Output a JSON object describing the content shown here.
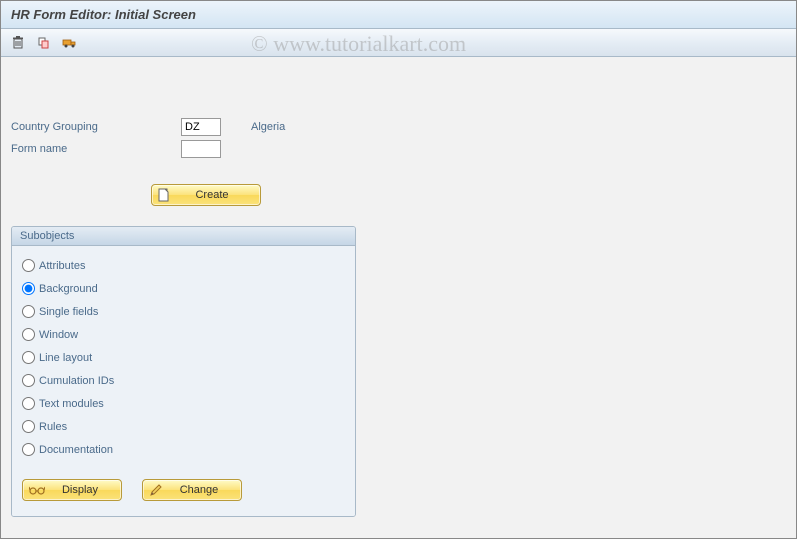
{
  "title": "HR Form Editor: Initial Screen",
  "watermark": "© www.tutorialkart.com",
  "form": {
    "country_grouping_label": "Country Grouping",
    "country_grouping_value": "DZ",
    "country_name": "Algeria",
    "form_name_label": "Form name",
    "form_name_value": ""
  },
  "buttons": {
    "create": "Create",
    "display": "Display",
    "change": "Change"
  },
  "subobjects": {
    "title": "Subobjects",
    "items": [
      {
        "label": "Attributes",
        "checked": false
      },
      {
        "label": "Background",
        "checked": true
      },
      {
        "label": "Single fields",
        "checked": false
      },
      {
        "label": "Window",
        "checked": false
      },
      {
        "label": "Line layout",
        "checked": false
      },
      {
        "label": "Cumulation IDs",
        "checked": false
      },
      {
        "label": "Text modules",
        "checked": false
      },
      {
        "label": "Rules",
        "checked": false
      },
      {
        "label": "Documentation",
        "checked": false
      }
    ]
  }
}
